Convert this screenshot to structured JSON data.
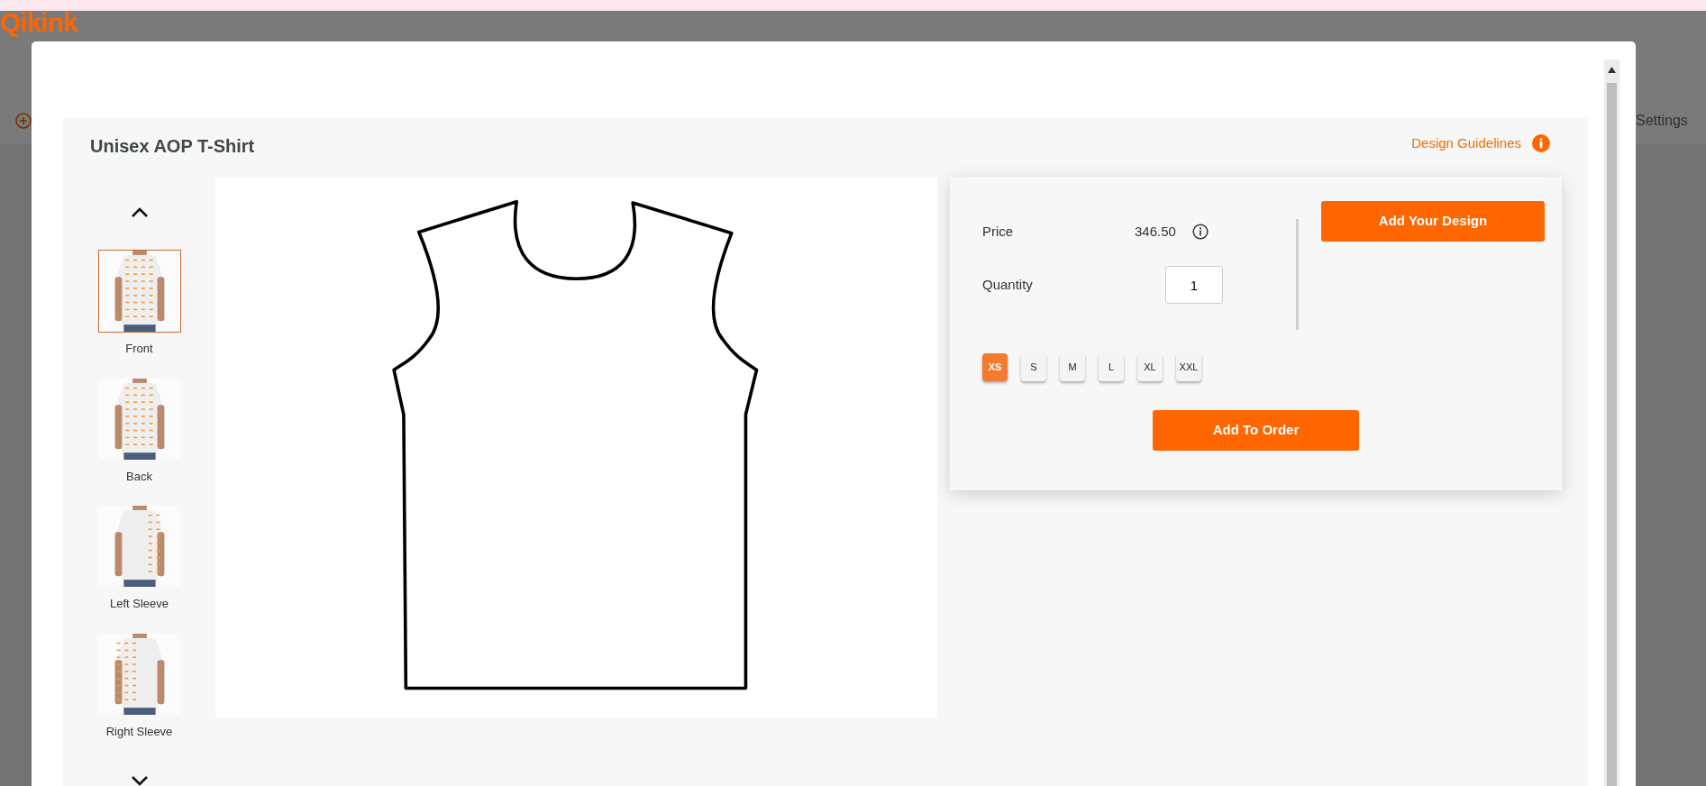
{
  "backdrop": {
    "logo": "Qikink",
    "header_link": "Settings"
  },
  "modal": {
    "title": "Unisex AOP T-Shirt",
    "guidelines_link": "Design Guidelines",
    "views": [
      {
        "label": "Front",
        "selected": true
      },
      {
        "label": "Back",
        "selected": false
      },
      {
        "label": "Left Sleeve",
        "selected": false
      },
      {
        "label": "Right Sleeve",
        "selected": false
      }
    ],
    "price": {
      "label": "Price",
      "value": "346.50"
    },
    "quantity": {
      "label": "Quantity",
      "value": "1"
    },
    "sizes": [
      {
        "label": "XS",
        "selected": true
      },
      {
        "label": "S",
        "selected": false
      },
      {
        "label": "M",
        "selected": false
      },
      {
        "label": "L",
        "selected": false
      },
      {
        "label": "XL",
        "selected": false
      },
      {
        "label": "XXL",
        "selected": false
      }
    ],
    "add_design_button": "Add Your Design",
    "add_to_order_button": "Add To Order"
  }
}
